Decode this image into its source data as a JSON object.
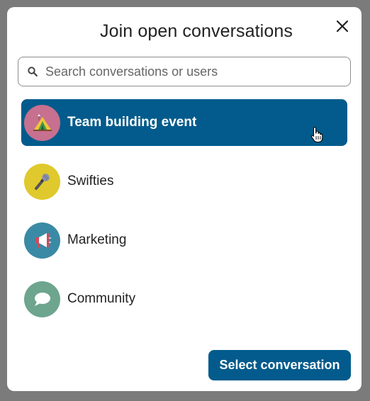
{
  "dialog": {
    "title": "Join open conversations",
    "close_icon": "close-icon"
  },
  "search": {
    "placeholder": "Search conversations or users",
    "value": "",
    "icon": "search-icon"
  },
  "conversations": [
    {
      "label": "Team building event",
      "icon": "tent-icon",
      "avatar_color": "#c7708f",
      "selected": true
    },
    {
      "label": "Swifties",
      "icon": "microphone-icon",
      "avatar_color": "#dfc92c",
      "selected": false
    },
    {
      "label": "Marketing",
      "icon": "megaphone-icon",
      "avatar_color": "#3a8aa5",
      "selected": false
    },
    {
      "label": "Community",
      "icon": "speech-bubble-icon",
      "avatar_color": "#6ea58f",
      "selected": false
    }
  ],
  "footer": {
    "select_label": "Select conversation"
  },
  "colors": {
    "accent": "#025b8c",
    "overlay": "#7b7b7b"
  }
}
